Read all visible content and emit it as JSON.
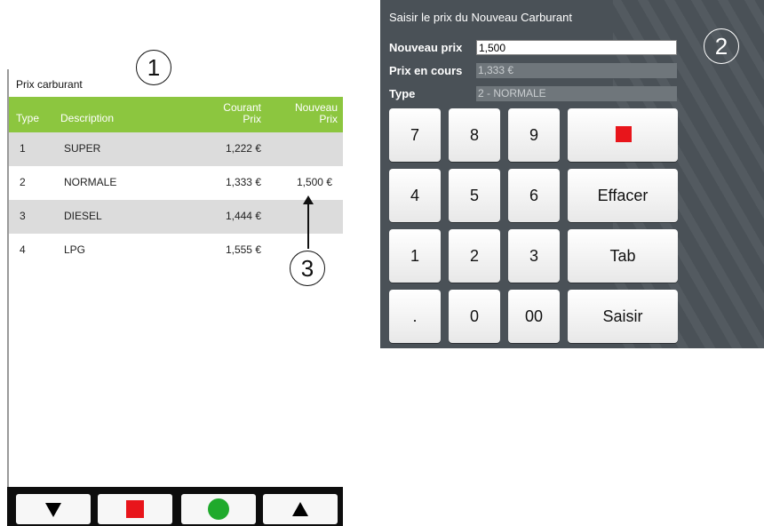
{
  "left_panel": {
    "title": "Prix carburant",
    "callout": "1",
    "columns": {
      "type": "Type",
      "description": "Description",
      "courant": "Courant\nPrix",
      "nouveau": "Nouveau\nPrix"
    },
    "rows": [
      {
        "type": "1",
        "description": "SUPER",
        "courant": "1,222 €",
        "nouveau": ""
      },
      {
        "type": "2",
        "description": "NORMALE",
        "courant": "1,333 €",
        "nouveau": "1,500 €"
      },
      {
        "type": "3",
        "description": "DIESEL",
        "courant": "1,444 €",
        "nouveau": ""
      },
      {
        "type": "4",
        "description": "LPG",
        "courant": "1,555 €",
        "nouveau": ""
      }
    ],
    "arrow_callout": "3",
    "bottom_bar": {
      "buttons": [
        "down-triangle-icon",
        "stop-square-icon",
        "ok-circle-icon",
        "up-triangle-icon"
      ]
    }
  },
  "right_panel": {
    "title": "Saisir le prix du Nouveau Carburant",
    "callout": "2",
    "fields": {
      "nouveau_prix": {
        "label": "Nouveau prix",
        "value": "1,500"
      },
      "prix_en_cours": {
        "label": "Prix en cours",
        "value": "1,333 €"
      },
      "type": {
        "label": "Type",
        "value": "2 - NORMALE"
      }
    },
    "keypad": {
      "k7": "7",
      "k8": "8",
      "k9": "9",
      "k4": "4",
      "k5": "5",
      "k6": "6",
      "k1": "1",
      "k2": "2",
      "k3": "3",
      "kdot": ".",
      "k0": "0",
      "k00": "00",
      "effacer": "Effacer",
      "tab": "Tab",
      "saisir": "Saisir"
    }
  },
  "colors": {
    "header_green": "#8cc63f",
    "panel_gray": "#4a5157",
    "stop_red": "#e8151b",
    "ok_green": "#1faa2c"
  }
}
